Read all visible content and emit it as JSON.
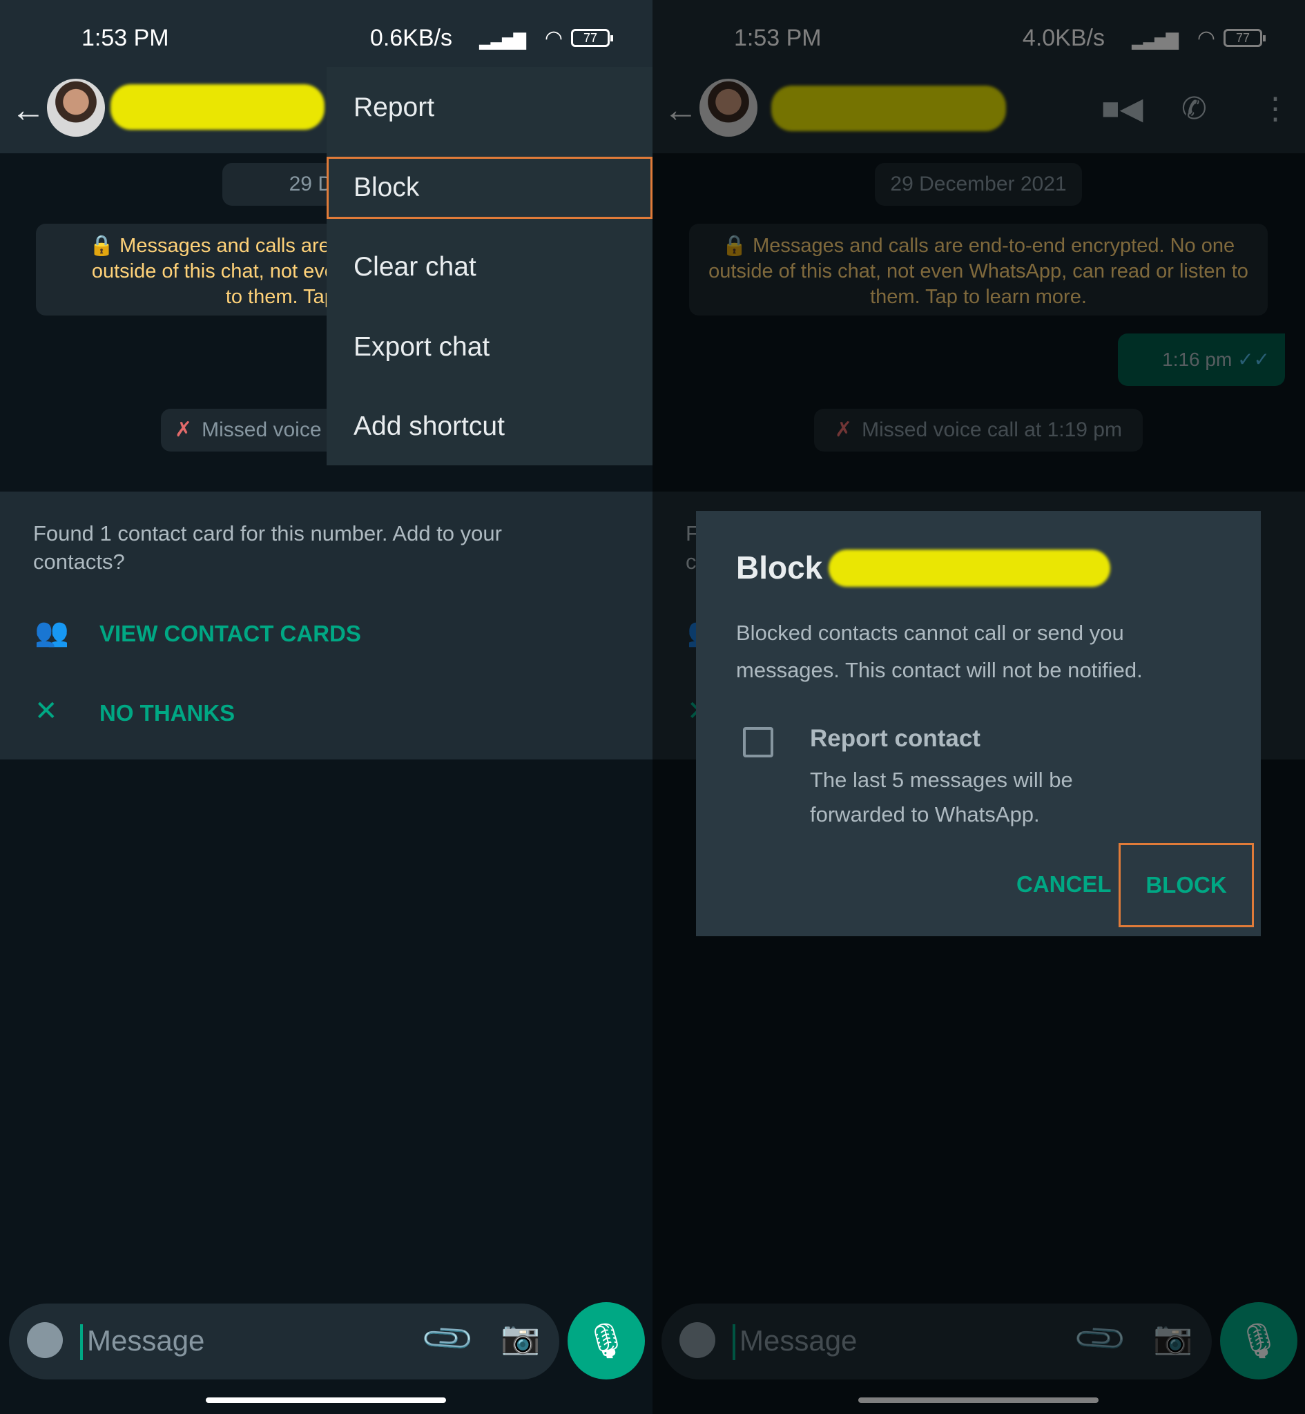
{
  "status_left": {
    "time": "1:53 PM",
    "speed": "0.6KB/s",
    "battery": "77"
  },
  "status_right": {
    "time": "1:53 PM",
    "speed": "4.0KB/s",
    "battery": "77"
  },
  "chat": {
    "date_chip": "29 December 2021",
    "encryption_notice": "Messages and calls are end-to-end encrypted. No one outside of this chat, not even WhatsApp, can read or listen to them. Tap to learn more.",
    "outgoing_time": "1:16 pm",
    "missed_call": "Missed voice call at 1:19 pm",
    "missed_call_partial": "Missed voice",
    "date_partial": "29 Decem",
    "enc_partial_1": "Messages and calls are e",
    "enc_partial_2": "outside of this chat, not even",
    "enc_partial_3": "to them. Tap t"
  },
  "contact_card": {
    "message": "Found 1 contact card for this number. Add to your contacts?",
    "view_label": "VIEW CONTACT CARDS",
    "no_thanks_label": "NO THANKS"
  },
  "input": {
    "placeholder": "Message"
  },
  "menu": {
    "items": [
      {
        "label": "Report"
      },
      {
        "label": "Block",
        "highlighted": true
      },
      {
        "label": "Clear chat"
      },
      {
        "label": "Export chat"
      },
      {
        "label": "Add shortcut"
      }
    ]
  },
  "dialog": {
    "title": "Block",
    "body": "Blocked contacts cannot call or send you messages. This contact will not be notified.",
    "report_label": "Report contact",
    "report_checked": false,
    "report_sub": "The last 5 messages will be forwarded to WhatsApp.",
    "cancel_label": "CANCEL",
    "block_label": "BLOCK"
  },
  "colors": {
    "accent": "#00a884",
    "highlight": "#e07b39",
    "redaction": "#f5f000",
    "notice": "#ffd279"
  },
  "icons": [
    "back-arrow-icon",
    "video-call-icon",
    "voice-call-icon",
    "more-options-icon",
    "lock-icon",
    "missed-call-icon",
    "contacts-icon",
    "close-icon",
    "emoji-icon",
    "attach-icon",
    "camera-icon",
    "mic-icon"
  ]
}
